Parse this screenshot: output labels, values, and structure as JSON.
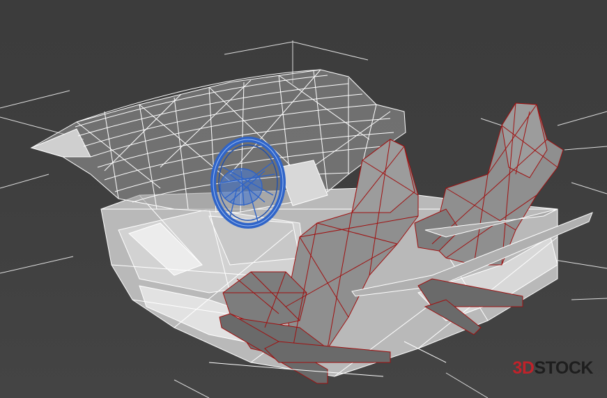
{
  "viewport": {
    "background": "#3e3e3e",
    "grid_color": "#f2f2f2",
    "wireframe_colors": {
      "body": "#ffffff",
      "steering_wheel": "#2f64c8",
      "seats": "#a01010",
      "seat_fill": "#8e8e8e"
    }
  },
  "watermark": {
    "prefix": "3D",
    "suffix": "STOCK",
    "prefix_color": "#c0222a",
    "suffix_color": "#1e1e1e"
  }
}
